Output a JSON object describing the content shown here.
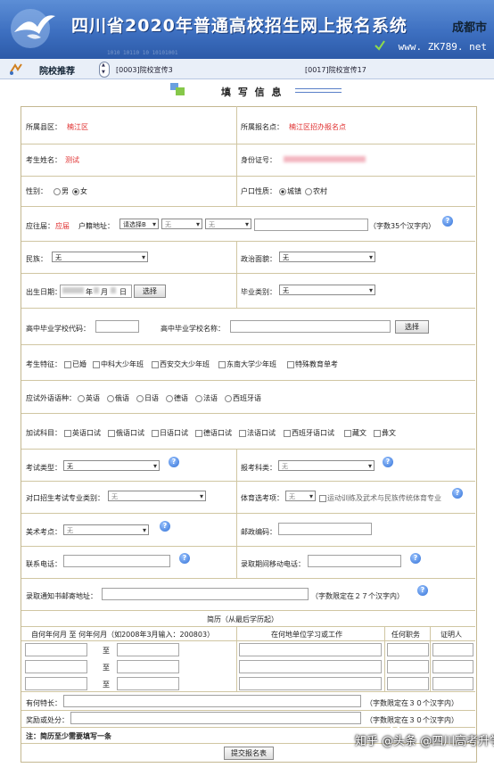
{
  "header": {
    "title": "四川省2020年普通高校招生网上报名系统",
    "city": "成都市",
    "url": "www. ZK789. net",
    "binary_decor": "1010 10110 10 10101001"
  },
  "nav": {
    "label": "院校推荐",
    "link1": "[0003]院校宣传3",
    "link2": "[0017]院校宣传17"
  },
  "page": {
    "heading": "填 写 信 息"
  },
  "form": {
    "county_label": "所属县区：",
    "county_value": "楠江区",
    "station_label": "所属报名点：",
    "station_value": "楠江区招办报名点",
    "name_label": "考生姓名：",
    "name_value": "测试",
    "id_label": "身份证号：",
    "gender_label": "性别：",
    "gender_options": [
      "男",
      "女"
    ],
    "hukou_label": "户口性质：",
    "hukou_options": [
      "城镇",
      "农村"
    ],
    "graduate_label": "应往届：",
    "graduate_value": "应届",
    "address_label": "户籍地址：",
    "address_select1": "请选择B",
    "address_select2": "无",
    "address_select3": "无",
    "address_hint": "（字数35个汉字内）",
    "ethnic_label": "民族：",
    "ethnic_value": "无",
    "political_label": "政治面貌：",
    "political_value": "无",
    "birth_label": "出生日期：",
    "birth_year": "年",
    "birth_month": "月",
    "birth_day": "日",
    "select_button": "选择",
    "grad_type_label": "毕业类别：",
    "grad_type_value": "无",
    "school_code_label": "高中毕业学校代码：",
    "school_name_label": "高中毕业学校名称：",
    "school_select_button": "选择",
    "features_label": "考生特征：",
    "features": [
      "已婚",
      "中科大少年班",
      "西安交大少年班",
      "东南大学少年班",
      "特殊教育单考"
    ],
    "lang_label": "应试外语语种：",
    "langs": [
      "英语",
      "俄语",
      "日语",
      "德语",
      "法语",
      "西班牙语"
    ],
    "extra_label": "加试科目：",
    "extras": [
      "英语口试",
      "俄语口试",
      "日语口试",
      "德语口试",
      "法语口试",
      "西班牙语口试",
      "藏文",
      "彝文"
    ],
    "exam_type_label": "考试类型：",
    "exam_type_value": "无",
    "subject_label": "报考科类：",
    "subject_value": "无",
    "vocational_label": "对口招生考试专业类别：",
    "vocational_value": "无",
    "sports_label": "体育选考项：",
    "sports_value": "无",
    "sports_check": "运动训练及武术与民族传统体育专业",
    "art_label": "美术考点：",
    "art_value": "无",
    "postal_label": "邮政编码：",
    "phone_label": "联系电话：",
    "mobile_label": "录取期间移动电话：",
    "mail_label": "录取通知书邮寄地址：",
    "mail_hint": "（字数限定在２７个汉字内）",
    "resume_title": "简历（从最后学历起）",
    "resume_cols": [
      "自何年何月  至  何年何月（如2008年3月输入：200803）",
      "在何地单位学习或工作",
      "任何职务",
      "证明人"
    ],
    "to_label": "至",
    "specialty_label": "有何特长：",
    "specialty_hint": "（字数限定在３０个汉字内）",
    "reward_label": "奖励或处分：",
    "reward_hint": "（字数限定在３０个汉字内）",
    "note": "注：简历至少需要填写一条",
    "submit": "提交报名表"
  },
  "watermark": "知乎 @头条 @四川高考升学"
}
